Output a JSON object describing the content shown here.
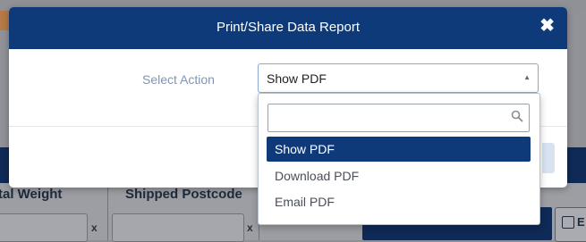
{
  "background": {
    "columns": [
      "tal Weight",
      "Shipped Postcode"
    ],
    "clear_glyph": "x"
  },
  "modal": {
    "title": "Print/Share Data Report",
    "close_glyph": "✖",
    "select": {
      "label": "Select Action",
      "value": "Show PDF",
      "caret": "▲",
      "search_placeholder": "",
      "options": [
        {
          "label": "Show PDF",
          "selected": true
        },
        {
          "label": "Download PDF",
          "selected": false
        },
        {
          "label": "Email PDF",
          "selected": false
        }
      ]
    }
  },
  "colors": {
    "header": "#0f3a7a",
    "selected_option": "#0f3a7a",
    "label": "#7f95b6"
  }
}
